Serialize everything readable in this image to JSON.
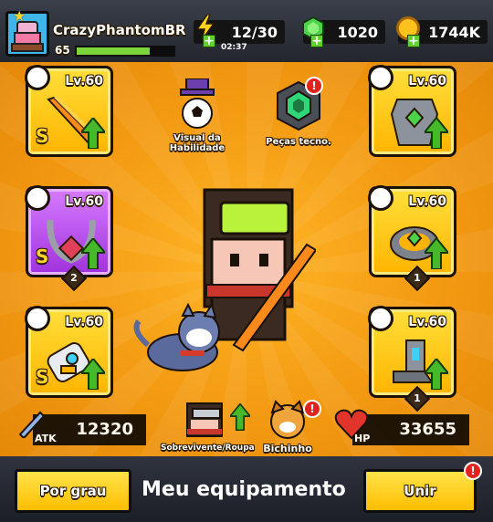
{
  "player": {
    "name": "CrazyPhantomBR",
    "level": "65",
    "xp_fraction": 0.75
  },
  "resources": {
    "energy": {
      "value": "12/30",
      "timer": "02:37",
      "icon": "lightning-icon"
    },
    "gems": {
      "value": "1020",
      "icon": "gem-icon"
    },
    "coins": {
      "value": "1744K",
      "icon": "coin-icon"
    }
  },
  "equipment": {
    "weapon": {
      "level": "Lv.60",
      "rank": "S",
      "icon": "sword-icon"
    },
    "necklace": {
      "level": "Lv.60",
      "rank": "S",
      "count": "2",
      "icon": "necklace-icon"
    },
    "gloves": {
      "level": "Lv.60",
      "rank": "S",
      "icon": "gauntlet-icon"
    },
    "armor": {
      "level": "Lv.60",
      "icon": "armor-icon"
    },
    "belt": {
      "level": "Lv.60",
      "count": "1",
      "icon": "belt-icon"
    },
    "boots": {
      "level": "Lv.60",
      "count": "1",
      "icon": "boots-icon"
    }
  },
  "menu": {
    "skill_visual": "Visual da Habilidade",
    "tech_parts": "Peças tecno.",
    "survivor_outfit": "Sobrevivente/Roupa",
    "pet": "Bichinho",
    "alert": "!"
  },
  "stats": {
    "atk_label": "ATK",
    "atk_value": "12320",
    "hp_label": "HP",
    "hp_value": "33655"
  },
  "bottom": {
    "sort_button": "Por grau",
    "title": "Meu equipamento",
    "merge_button": "Unir"
  },
  "colors": {
    "gold_slot": "#ffc400",
    "purple_slot": "#b845e6",
    "upgrade_green": "#46b82a",
    "background": "#f39a12"
  }
}
